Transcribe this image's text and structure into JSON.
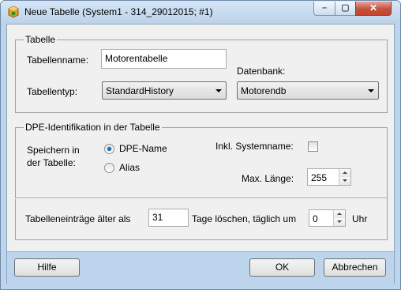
{
  "window": {
    "title": "Neue Tabelle (System1 - 314_29012015; #1)",
    "icon": "app-icon",
    "controls": {
      "minimize": "–",
      "maximize": "▢",
      "close": "✕"
    }
  },
  "group_tabelle": {
    "legend": "Tabelle",
    "tablename_label": "Tabellenname:",
    "tablename_value": "Motorentabelle",
    "datenbank_label": "Datenbank:",
    "tabletype_label": "Tabellentyp:",
    "tabletype_value": "StandardHistory",
    "datenbank_value": "Motorendb"
  },
  "group_dpe": {
    "legend": "DPE-Identifikation in der Tabelle",
    "save_label_line1": "Speichern in",
    "save_label_line2": "der Tabelle:",
    "radio_dpe_name": "DPE-Name",
    "radio_alias": "Alias",
    "selected": "DPE-Name",
    "incl_systemname_label": "Inkl. Systemname:",
    "incl_systemname_checked": false,
    "max_length_label": "Max. Länge:",
    "max_length_value": "255",
    "entries_label": "Tabelleneinträge älter als",
    "days_value": "31",
    "delete_label": "Tage löschen, täglich um",
    "hour_value": "0",
    "hour_unit": "Uhr"
  },
  "buttons": {
    "help": "Hilfe",
    "ok": "OK",
    "cancel": "Abbrechen"
  },
  "colors": {
    "frame": "#bcd4ec",
    "client": "#f0f0f0",
    "radio_dot": "#1e6ec8",
    "close_button": "#c7422a"
  }
}
